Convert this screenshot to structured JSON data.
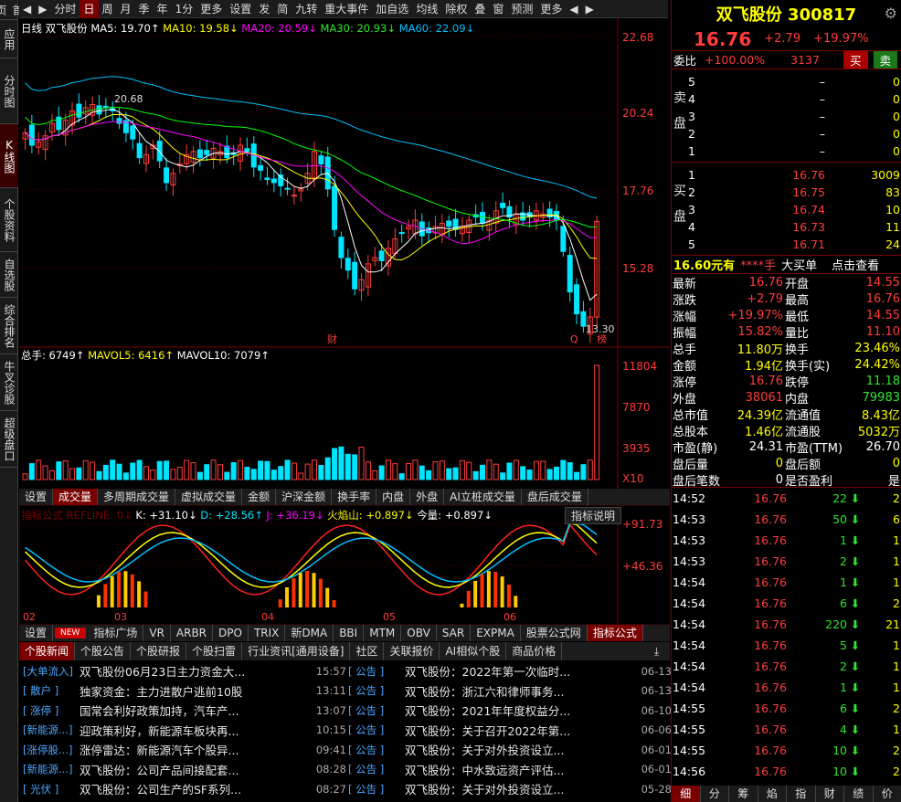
{
  "leftnav": [
    "首页",
    "应用",
    "分时图",
    "K线图",
    "个股资料",
    "自选股",
    "综合排名",
    "牛叉诊股",
    "超级盘口"
  ],
  "toolbar": {
    "items": [
      "◀",
      "▶",
      "分时",
      "日",
      "周",
      "月",
      "季",
      "年",
      "1分",
      "更多",
      "设置",
      "发",
      "简",
      "九转",
      "重大事件",
      "加自选",
      "均线",
      "除权",
      "叠",
      "窗",
      "预测",
      "更多",
      "◀",
      "▶"
    ],
    "selected_index": 3
  },
  "legend": {
    "period": "日线",
    "name": "双飞股份",
    "ma5": "MA5: 19.70↑",
    "ma10": "MA10: 19.58↓",
    "ma20": "MA20: 20.59↓",
    "ma30": "MA30: 20.93↓",
    "ma60": "MA60: 22.09↓",
    "high_mark": "20.68",
    "low_mark": "13.30",
    "tag_cai": "财",
    "tag_q": "Q",
    "tag_bang": "榜"
  },
  "price_axis": [
    "22.68",
    "20.24",
    "17.76",
    "15.28"
  ],
  "vol_legend": {
    "total": "总手: 6749↑",
    "mavol5": "MAVOL5: 6416↑",
    "mavol10": "MAVOL10: 7079↑"
  },
  "vol_axis": [
    "11804",
    "7870",
    "3935",
    "X10"
  ],
  "bottom_tabs": [
    "设置",
    "成交量",
    "多周期成交量",
    "虚拟成交量",
    "金额",
    "沪深金额",
    "换手率",
    "内盘",
    "外盘",
    "AI立桩成交量",
    "盘后成交量"
  ],
  "bottom_tabs_selected": 1,
  "ind_legend": {
    "name": "指标公式 REFLINE: 0↓",
    "k": "K: +31.10↓",
    "d": "D: +28.56↑",
    "j": "J: +36.19↓",
    "huo": "火焰山: +0.897↓",
    "jin": "今量: +0.897↓",
    "explain": "指标说明"
  },
  "ind_axis": [
    "+91.73",
    "+46.36"
  ],
  "months": [
    "02",
    "03",
    "04",
    "05",
    "06"
  ],
  "ind_tabs": [
    "设置",
    "NEW",
    "指标广场",
    "VR",
    "ARBR",
    "DPO",
    "TRIX",
    "新DMA",
    "BBI",
    "MTM",
    "OBV",
    "SAR",
    "EXPMA",
    "股票公式网",
    "指标公式"
  ],
  "news_tabs": [
    "个股新闻",
    "个股公告",
    "个股研报",
    "个股扫雷",
    "行业资讯[通用设备]",
    "社区",
    "关联报价",
    "AI相似个股",
    "商品价格"
  ],
  "news_left": [
    {
      "tag": "[大单流入]",
      "title": "双飞股份06月23日主力资金大...",
      "time": "15:57"
    },
    {
      "tag": "[  散户  ]",
      "title": "独家资金：主力进散户逃前10股",
      "time": "13:11"
    },
    {
      "tag": "[  涨停  ]",
      "title": "国常会利好政策加持，汽车产...",
      "time": "13:07"
    },
    {
      "tag": "[新能源...]",
      "title": "迎政策利好，新能源车板块再...",
      "time": "10:15"
    },
    {
      "tag": "[涨停股...]",
      "title": "涨停雷达：新能源汽车个股异...",
      "time": "09:41"
    },
    {
      "tag": "[新能源...]",
      "title": "双飞股份：公司产品间接配套...",
      "time": "08:28"
    },
    {
      "tag": "[  光伏  ]",
      "title": "双飞股份：公司生产的SF系列...",
      "time": "08:27"
    }
  ],
  "news_right": [
    {
      "tag": "[  公告  ]",
      "title": "双飞股份：2022年第一次临时...",
      "time": "06-13"
    },
    {
      "tag": "[  公告  ]",
      "title": "双飞股份：浙江六和律师事务...",
      "time": "06-13"
    },
    {
      "tag": "[  公告  ]",
      "title": "双飞股份：2021年年度权益分...",
      "time": "06-10"
    },
    {
      "tag": "[  公告  ]",
      "title": "双飞股份：关于召开2022年第...",
      "time": "06-06"
    },
    {
      "tag": "[  公告  ]",
      "title": "双飞股份：关于对外投资设立...",
      "time": "06-01"
    },
    {
      "tag": "[  公告  ]",
      "title": "双飞股份：中水致远资产评估...",
      "time": "06-01"
    },
    {
      "tag": "[  公告  ]",
      "title": "双飞股份：关于对外投资设立...",
      "time": "05-28"
    }
  ],
  "quote": {
    "name_code": "双飞股份 300817",
    "price": "16.76",
    "change": "+2.79",
    "pct": "+19.97%",
    "weibi_label": "委比",
    "weibi": "+100.00%",
    "weicha": "3137",
    "buy_btn": "买",
    "sell_btn": "卖",
    "sell_label": "卖盘",
    "buy_label": "买盘",
    "sell": [
      {
        "lv": "5",
        "p": "–",
        "v": "0"
      },
      {
        "lv": "4",
        "p": "–",
        "v": "0"
      },
      {
        "lv": "3",
        "p": "–",
        "v": "0"
      },
      {
        "lv": "2",
        "p": "–",
        "v": "0"
      },
      {
        "lv": "1",
        "p": "–",
        "v": "0"
      }
    ],
    "buy": [
      {
        "lv": "1",
        "p": "16.76",
        "v": "3009"
      },
      {
        "lv": "2",
        "p": "16.75",
        "v": "83"
      },
      {
        "lv": "3",
        "p": "16.74",
        "v": "10"
      },
      {
        "lv": "4",
        "p": "16.73",
        "v": "11"
      },
      {
        "lv": "5",
        "p": "16.71",
        "v": "24"
      }
    ],
    "bar_text": "16.60元有",
    "bar_stars": "****手",
    "bar_big": "大买单",
    "bar_link": "点击查看",
    "stats": [
      [
        "最新",
        "16.76",
        "red",
        "开盘",
        "14.55",
        "red"
      ],
      [
        "涨跌",
        "+2.79",
        "red",
        "最高",
        "16.76",
        "red"
      ],
      [
        "涨幅",
        "+19.97%",
        "red",
        "最低",
        "14.55",
        "red"
      ],
      [
        "振幅",
        "15.82%",
        "red",
        "量比",
        "11.10",
        "red"
      ],
      [
        "总手",
        "11.80万",
        "yel",
        "换手",
        "23.46%",
        "yel"
      ],
      [
        "金额",
        "1.94亿",
        "yel",
        "换手(实)",
        "24.42%",
        "yel"
      ],
      [
        "涨停",
        "16.76",
        "red",
        "跌停",
        "11.18",
        "green"
      ],
      [
        "外盘",
        "38061",
        "red",
        "内盘",
        "79983",
        "green"
      ],
      [
        "总市值",
        "24.39亿",
        "yel",
        "流通值",
        "8.43亿",
        "yel"
      ],
      [
        "总股本",
        "1.46亿",
        "yel",
        "流通股",
        "5032万",
        "yel"
      ],
      [
        "市盈(静)",
        "24.31",
        "wht",
        "市盈(TTM)",
        "26.70",
        "wht"
      ],
      [
        "盘后量",
        "0",
        "yel",
        "盘后额",
        "0",
        "yel"
      ],
      [
        "盘后笔数",
        "0",
        "wht",
        "是否盈利",
        "是",
        "wht"
      ]
    ],
    "ticks": [
      {
        "t": "14:52",
        "p": "16.76",
        "v": "22",
        "n": "2"
      },
      {
        "t": "14:53",
        "p": "16.76",
        "v": "50",
        "n": "6"
      },
      {
        "t": "14:53",
        "p": "16.76",
        "v": "1",
        "n": "1"
      },
      {
        "t": "14:53",
        "p": "16.76",
        "v": "2",
        "n": "1"
      },
      {
        "t": "14:54",
        "p": "16.76",
        "v": "1",
        "n": "1"
      },
      {
        "t": "14:54",
        "p": "16.76",
        "v": "6",
        "n": "2"
      },
      {
        "t": "14:54",
        "p": "16.76",
        "v": "220",
        "n": "21"
      },
      {
        "t": "14:54",
        "p": "16.76",
        "v": "5",
        "n": "1"
      },
      {
        "t": "14:54",
        "p": "16.76",
        "v": "2",
        "n": "1"
      },
      {
        "t": "14:54",
        "p": "16.76",
        "v": "1",
        "n": "1"
      },
      {
        "t": "14:55",
        "p": "16.76",
        "v": "6",
        "n": "2"
      },
      {
        "t": "14:55",
        "p": "16.76",
        "v": "4",
        "n": "1"
      },
      {
        "t": "14:55",
        "p": "16.76",
        "v": "10",
        "n": "2"
      },
      {
        "t": "14:56",
        "p": "16.76",
        "v": "10",
        "n": "2"
      }
    ],
    "side_tabs": [
      "细",
      "分",
      "筹",
      "焰",
      "指",
      "财",
      "绩",
      "价"
    ]
  },
  "colors": {
    "up": "#ff3b3b",
    "down": "#00e5ff",
    "ma5": "#ffffff",
    "ma10": "#ffff00",
    "ma20": "#ff00ff",
    "ma30": "#00ff00",
    "ma60": "#00bfff",
    "axis": "#7a0000"
  }
}
